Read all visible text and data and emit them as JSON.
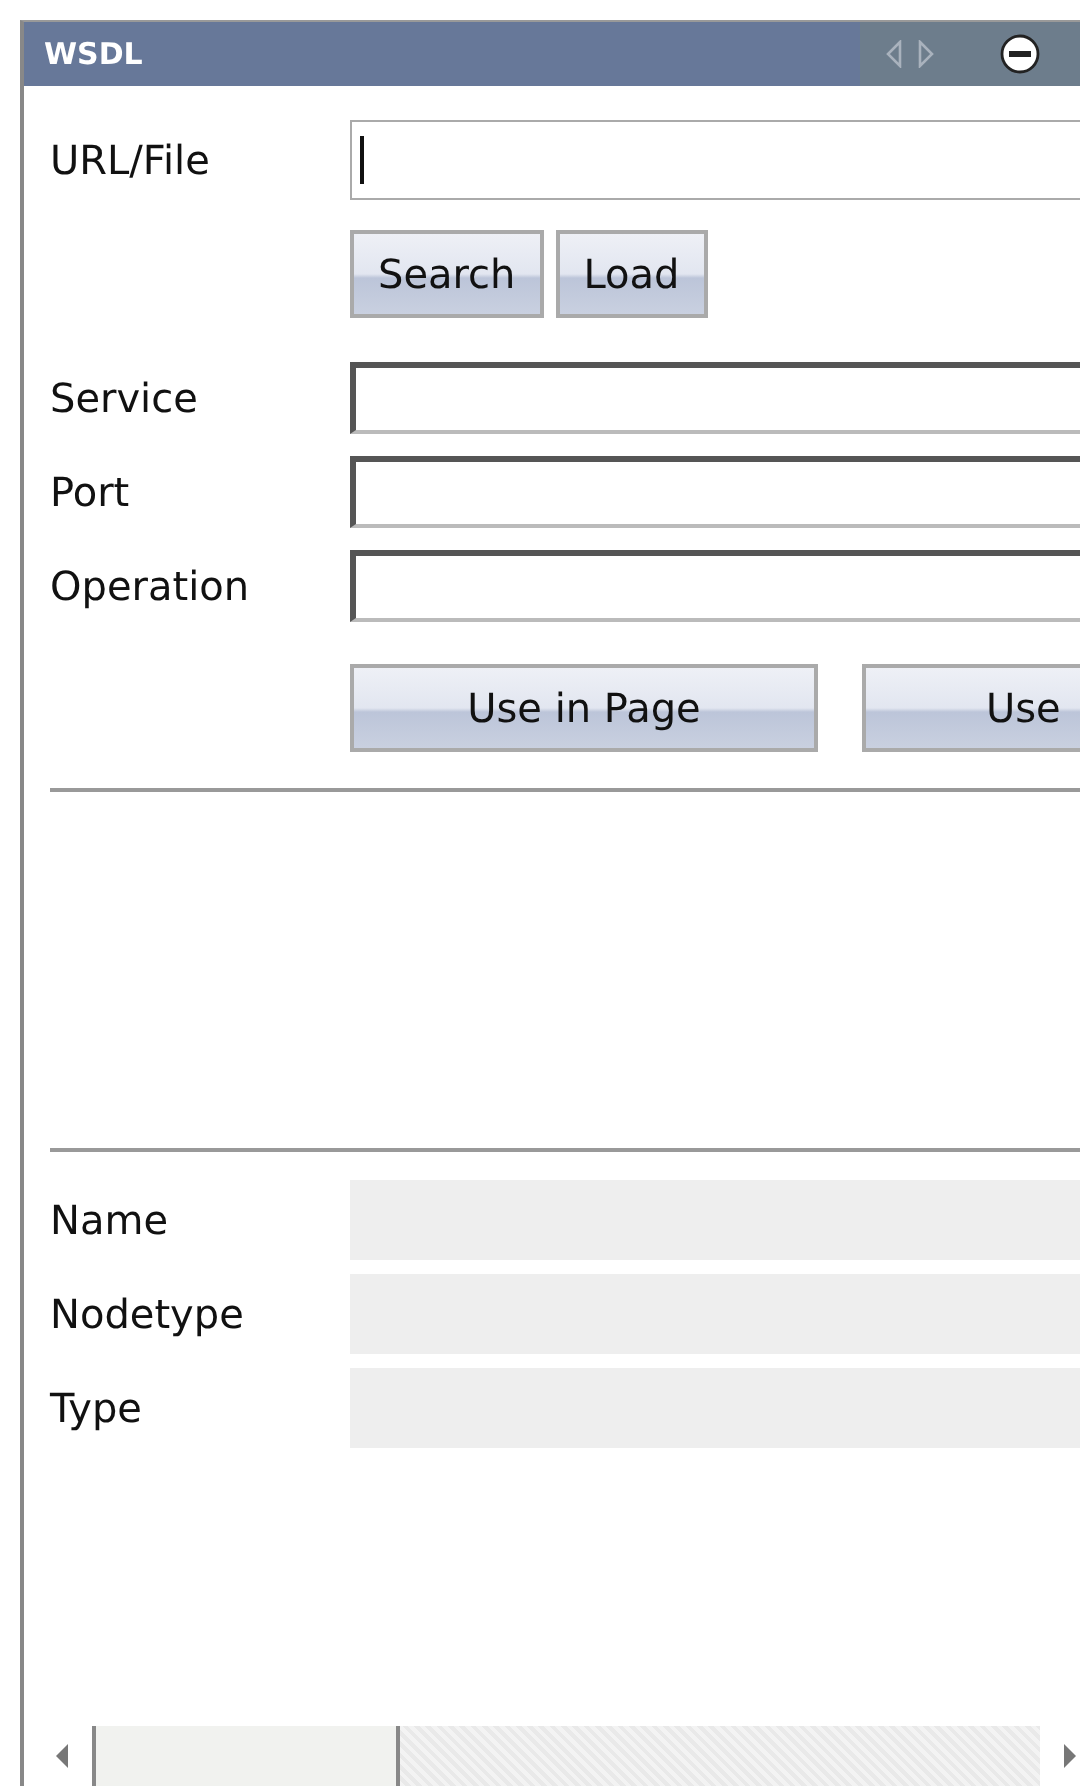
{
  "panel": {
    "title": "WSDL"
  },
  "source": {
    "label": "URL/File",
    "focused": true
  },
  "source_buttons": [
    "Search",
    "Load"
  ],
  "fields": [
    {
      "label": "Service"
    },
    {
      "label": "Port"
    },
    {
      "label": "Operation"
    }
  ],
  "use_buttons": [
    "Use in Page",
    "Use"
  ],
  "properties": [
    {
      "label": "Name"
    },
    {
      "label": "Nodetype"
    },
    {
      "label": "Type"
    }
  ]
}
